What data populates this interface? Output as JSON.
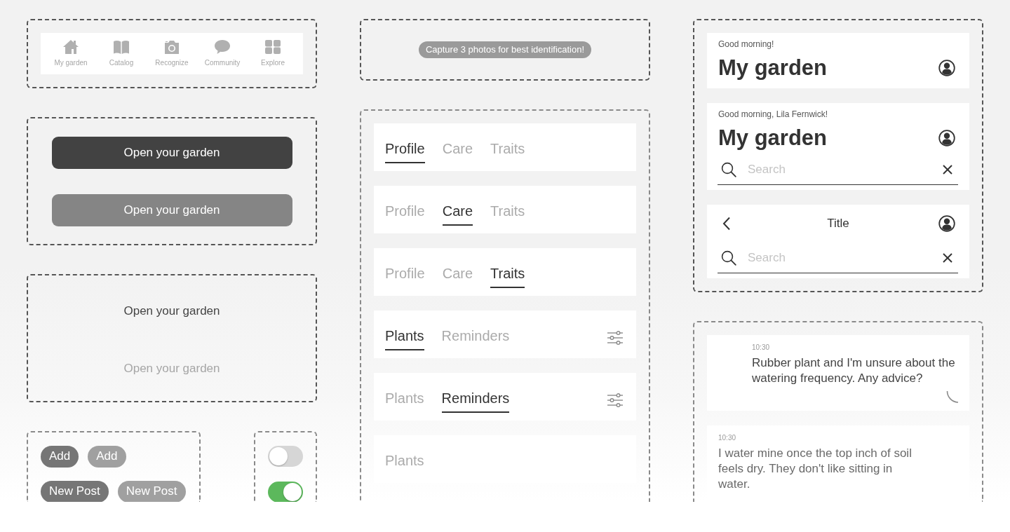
{
  "bottom_nav": {
    "items": [
      {
        "label": "My garden"
      },
      {
        "label": "Catalog"
      },
      {
        "label": "Recognize"
      },
      {
        "label": "Community"
      },
      {
        "label": "Explore"
      }
    ]
  },
  "filled_buttons": [
    {
      "label": "Open your garden",
      "disabled": false
    },
    {
      "label": "Open your garden",
      "disabled": true
    }
  ],
  "text_buttons": [
    {
      "label": "Open your garden",
      "disabled": false
    },
    {
      "label": "Open your garden",
      "disabled": true
    }
  ],
  "chip_rows": [
    {
      "chips": [
        {
          "label": "Add",
          "disabled": false
        },
        {
          "label": "Add",
          "disabled": true
        }
      ]
    },
    {
      "chips": [
        {
          "label": "New Post",
          "disabled": false
        },
        {
          "label": "New Post",
          "disabled": true
        }
      ]
    }
  ],
  "toggles": [
    {
      "on": false
    },
    {
      "on": true
    }
  ],
  "toast": {
    "text": "Capture 3 photos for best identification!"
  },
  "tab_bars": [
    {
      "tabs": [
        {
          "label": "Profile",
          "selected": true
        },
        {
          "label": "Care",
          "selected": false
        },
        {
          "label": "Traits",
          "selected": false
        }
      ],
      "filter_button": false
    },
    {
      "tabs": [
        {
          "label": "Profile",
          "selected": false
        },
        {
          "label": "Care",
          "selected": true
        },
        {
          "label": "Traits",
          "selected": false
        }
      ],
      "filter_button": false
    },
    {
      "tabs": [
        {
          "label": "Profile",
          "selected": false
        },
        {
          "label": "Care",
          "selected": false
        },
        {
          "label": "Traits",
          "selected": true
        }
      ],
      "filter_button": false
    },
    {
      "tabs": [
        {
          "label": "Plants",
          "selected": true
        },
        {
          "label": "Reminders",
          "selected": false
        }
      ],
      "filter_button": true
    },
    {
      "tabs": [
        {
          "label": "Plants",
          "selected": false
        },
        {
          "label": "Reminders",
          "selected": true
        }
      ],
      "filter_button": true
    },
    {
      "tabs": [
        {
          "label": "Plants",
          "selected": false
        }
      ],
      "filter_button": false
    }
  ],
  "headers": [
    {
      "kind": "large",
      "greeting": "Good morning!",
      "title": "My garden"
    },
    {
      "kind": "large",
      "greeting": "Good morning, Lila Fernwick!",
      "title": "My garden",
      "search": {
        "placeholder": "Search"
      }
    },
    {
      "kind": "compact",
      "title": "Title",
      "search": {
        "placeholder": "Search"
      }
    }
  ],
  "messages": [
    {
      "kind": "outgoing",
      "time": "10:30",
      "text": "Rubber plant and I'm unsure about the\nwatering frequency. Any advice?",
      "sending": true
    },
    {
      "kind": "incoming",
      "time": "10:30",
      "text": "I water mine once the top inch of soil\nfeels dry. They don't like sitting in\nwater.",
      "sending": false
    }
  ]
}
